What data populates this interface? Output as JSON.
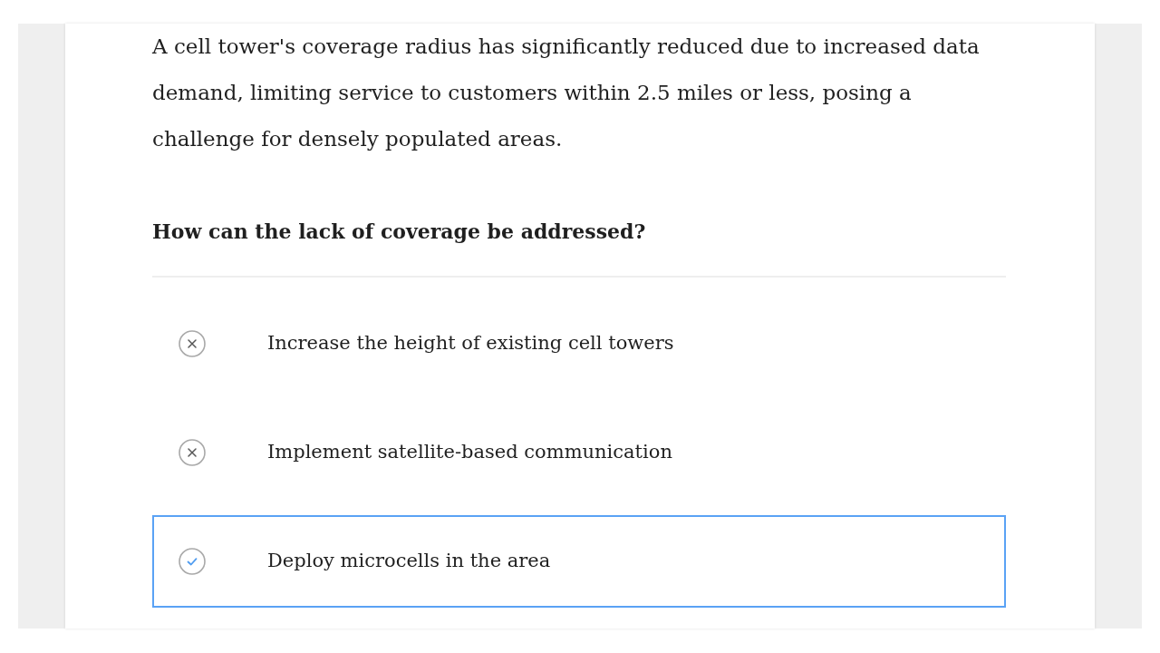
{
  "passage": "A cell tower's coverage radius has significantly reduced due to increased data demand, limiting service to customers within 2.5 miles or less, posing a challenge for densely populated areas.",
  "question": "How can the lack of coverage be addressed?",
  "options": [
    {
      "text": "Increase the height of existing cell towers",
      "correct": false,
      "selected": false
    },
    {
      "text": "Implement satellite-based communication",
      "correct": false,
      "selected": false
    },
    {
      "text": "Deploy microcells in the area",
      "correct": true,
      "selected": true
    }
  ]
}
